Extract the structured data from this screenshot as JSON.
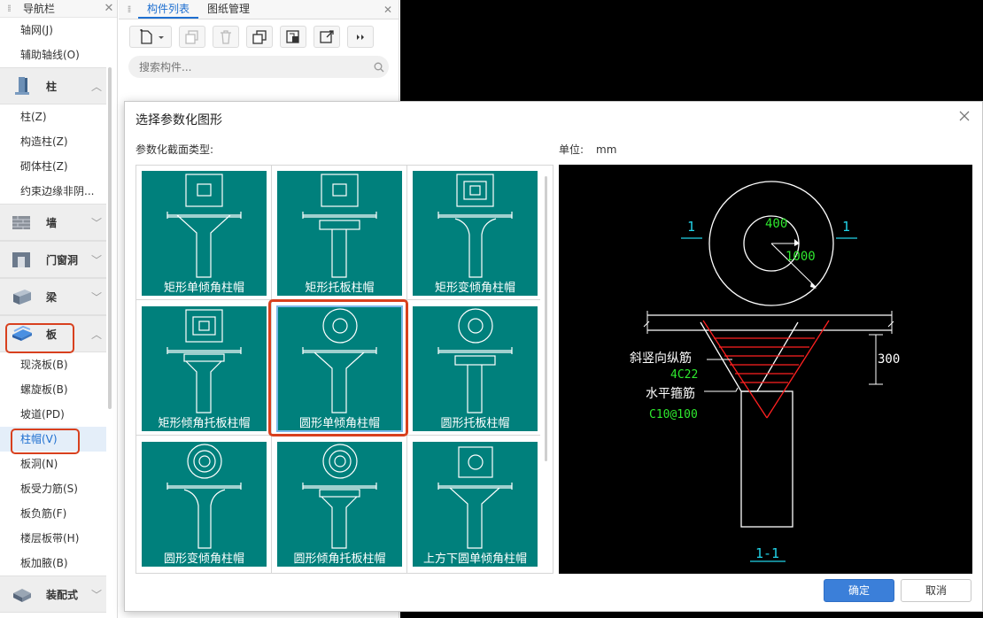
{
  "nav": {
    "title": "导航栏",
    "items_top": [
      "轴网(J)",
      "辅助轴线(O)"
    ],
    "group_column": "柱",
    "items_column": [
      "柱(Z)",
      "构造柱(Z)",
      "砌体柱(Z)",
      "约束边缘非阴..."
    ],
    "group_wall": "墙",
    "group_door": "门窗洞",
    "group_beam": "梁",
    "group_slab": "板",
    "items_slab": [
      "现浇板(B)",
      "螺旋板(B)",
      "坡道(PD)",
      "柱帽(V)",
      "板洞(N)",
      "板受力筋(S)",
      "板负筋(F)",
      "楼层板带(H)",
      "板加腋(B)"
    ],
    "group_prefab": "装配式",
    "selected_item": "柱帽(V)"
  },
  "mid": {
    "tab_components": "构件列表",
    "tab_drawings": "图纸管理",
    "search_placeholder": "搜索构件..."
  },
  "dialog": {
    "title": "选择参数化图形",
    "section_label": "参数化截面类型:",
    "unit_label": "单位:",
    "unit_value": "mm",
    "thumbnails": [
      "矩形单倾角柱帽",
      "矩形托板柱帽",
      "矩形变倾角柱帽",
      "矩形倾角托板柱帽",
      "圆形单倾角柱帽",
      "圆形托板柱帽",
      "圆形变倾角柱帽",
      "圆形倾角托板柱帽",
      "上方下圆单倾角柱帽"
    ],
    "selected_thumbnail": "圆形单倾角柱帽",
    "ok_label": "确定",
    "cancel_label": "取消"
  },
  "preview": {
    "section_mark_left": "1",
    "section_mark_right": "1",
    "dim_inner": "400",
    "dim_outer": "1000",
    "dim_height": "300",
    "label_slanted": "斜竖向纵筋",
    "value_slanted": "4C22",
    "label_horizontal": "水平箍筋",
    "value_horizontal": "C10@100",
    "section_caption": "1-1"
  },
  "colors": {
    "accent": "#1e6fd0",
    "thumb_bg": "#00807c",
    "highlight_red": "#d8401e",
    "cad_cyan": "#22d3e8",
    "cad_green": "#2ee82e",
    "cad_red": "#ff2020"
  }
}
